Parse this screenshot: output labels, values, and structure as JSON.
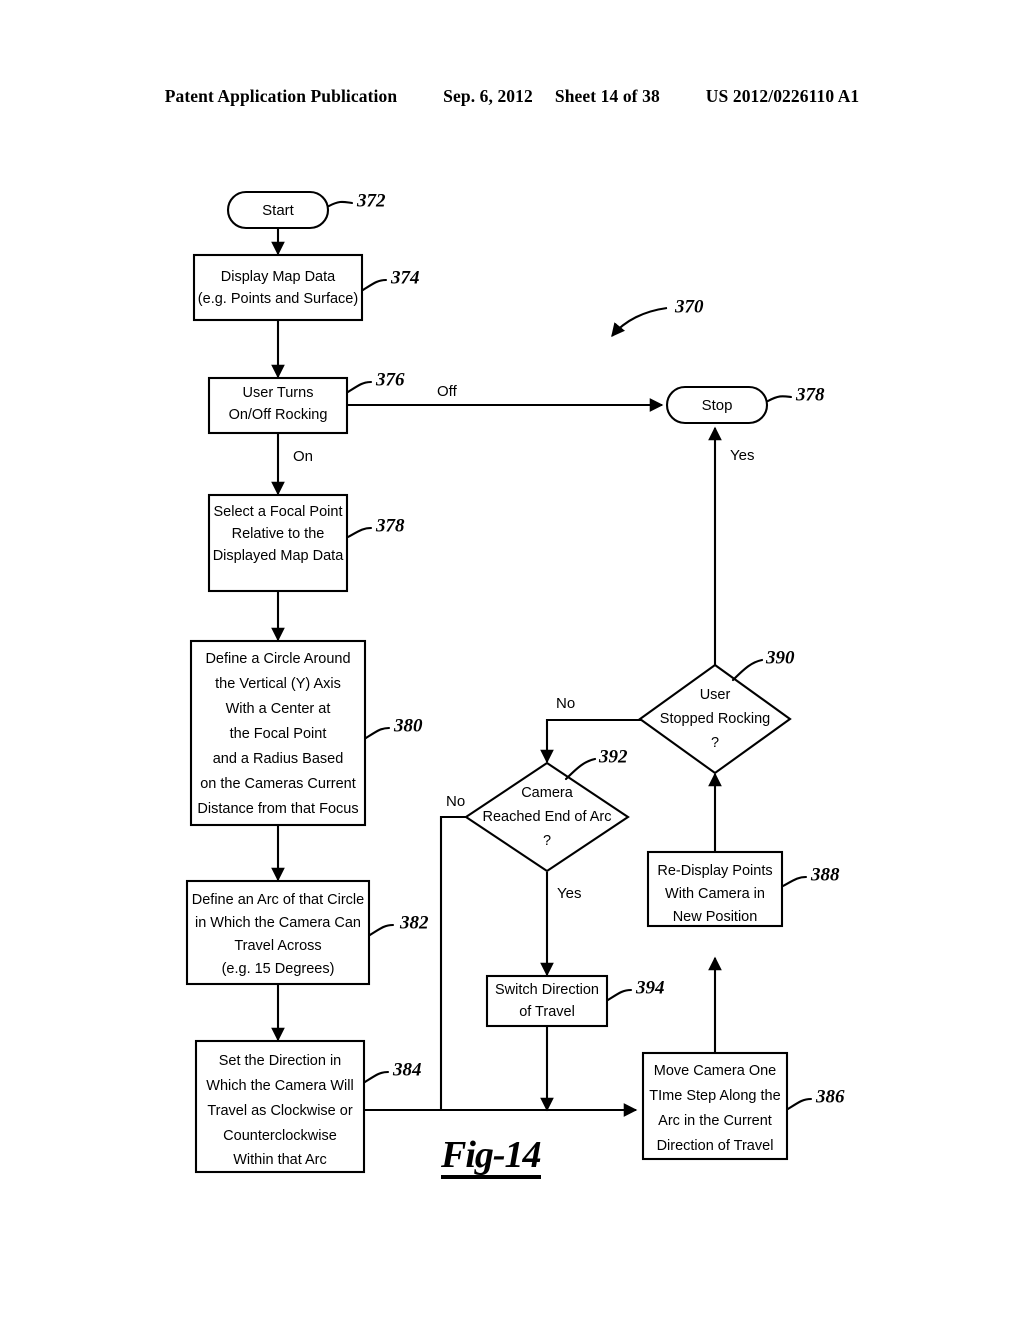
{
  "header": {
    "publication": "Patent Application Publication",
    "date": "Sep. 6, 2012",
    "sheet": "Sheet 14 of 38",
    "patent_number": "US 2012/0226110 A1"
  },
  "figure": {
    "caption": "Fig-14",
    "diagram_ref": "370"
  },
  "nodes": {
    "start": {
      "label": "Start",
      "ref": "372",
      "shape": "terminator"
    },
    "display_map": {
      "lines": [
        "Display Map Data",
        "(e.g. Points and Surface)"
      ],
      "ref": "374",
      "shape": "process"
    },
    "user_toggle": {
      "lines": [
        "User Turns",
        "On/Off Rocking"
      ],
      "ref": "376",
      "shape": "process"
    },
    "stop": {
      "label": "Stop",
      "ref": "378",
      "shape": "terminator"
    },
    "select_focal": {
      "lines": [
        "Select a Focal Point",
        "Relative to the",
        "Displayed Map Data"
      ],
      "ref": "378",
      "shape": "process"
    },
    "define_circle": {
      "lines": [
        "Define a Circle Around",
        "the Vertical (Y) Axis",
        "With a Center at",
        "the Focal Point",
        "and a Radius Based",
        "on the Cameras Current",
        "Distance from that Focus"
      ],
      "ref": "380",
      "shape": "process"
    },
    "define_arc": {
      "lines": [
        "Define an Arc of that Circle",
        "in Which the Camera Can",
        "Travel Across",
        "(e.g. 15 Degrees)"
      ],
      "ref": "382",
      "shape": "process"
    },
    "set_direction": {
      "lines": [
        "Set the Direction in",
        "Which the Camera Will",
        "Travel as Clockwise or",
        "Counterclockwise",
        "Within that Arc"
      ],
      "ref": "384",
      "shape": "process"
    },
    "move_camera": {
      "lines": [
        "Move Camera One",
        "TIme Step Along the",
        "Arc in the Current",
        "Direction of Travel"
      ],
      "ref": "386",
      "shape": "process"
    },
    "redisplay": {
      "lines": [
        "Re-Display Points",
        "With Camera in",
        "New Position"
      ],
      "ref": "388",
      "shape": "process"
    },
    "stopped_rocking": {
      "lines": [
        "User",
        "Stopped Rocking",
        "?"
      ],
      "ref": "390",
      "shape": "decision"
    },
    "reached_end": {
      "lines": [
        "Camera",
        "Reached End of Arc",
        "?"
      ],
      "ref": "392",
      "shape": "decision"
    },
    "switch_direction": {
      "lines": [
        "Switch Direction",
        "of Travel"
      ],
      "ref": "394",
      "shape": "process"
    }
  },
  "edge_labels": {
    "off": "Off",
    "on": "On",
    "yes_to_stop": "Yes",
    "no_from_390": "No",
    "no_from_392": "No",
    "yes_from_392": "Yes"
  }
}
